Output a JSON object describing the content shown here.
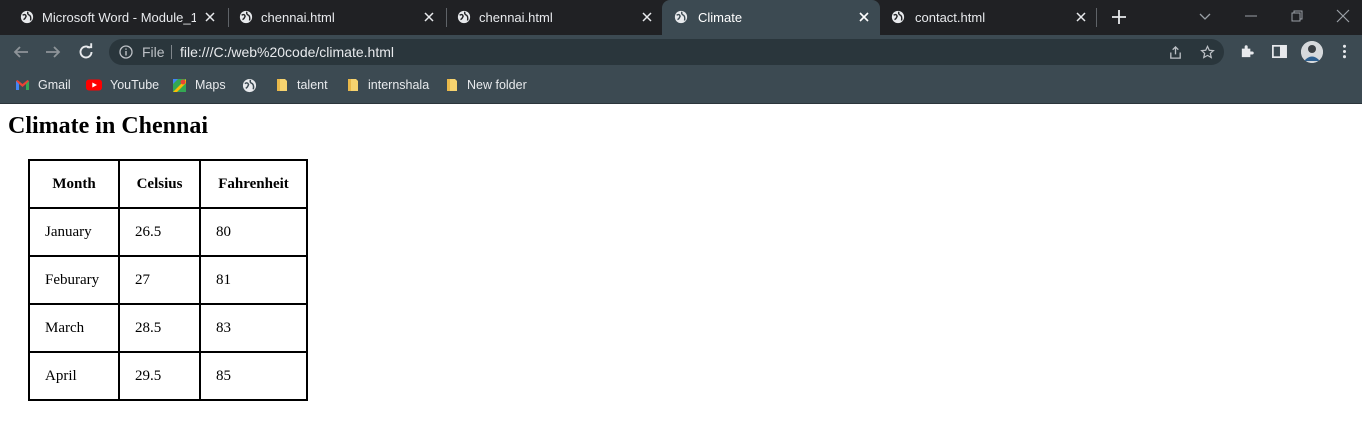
{
  "tabs": [
    {
      "label": "Microsoft Word - Module_1_",
      "active": false
    },
    {
      "label": "chennai.html",
      "active": false
    },
    {
      "label": "chennai.html",
      "active": false
    },
    {
      "label": "Climate",
      "active": true
    },
    {
      "label": "contact.html",
      "active": false
    }
  ],
  "address_bar": {
    "scheme_label": "File",
    "url": "file:///C:/web%20code/climate.html"
  },
  "bookmarks": [
    {
      "label": "Gmail",
      "icon": "gmail-icon"
    },
    {
      "label": "YouTube",
      "icon": "youtube-icon"
    },
    {
      "label": "Maps",
      "icon": "maps-icon"
    },
    {
      "label": "",
      "icon": "globe-icon"
    },
    {
      "label": "talent",
      "icon": "folder-icon"
    },
    {
      "label": "internshala",
      "icon": "folder-icon"
    },
    {
      "label": "New folder",
      "icon": "folder-icon"
    }
  ],
  "page": {
    "heading": "Climate in Chennai",
    "table": {
      "headers": [
        "Month",
        "Celsius",
        "Fahrenheit"
      ],
      "rows": [
        [
          "January",
          "26.5",
          "80"
        ],
        [
          "Feburary",
          "27",
          "81"
        ],
        [
          "March",
          "28.5",
          "83"
        ],
        [
          "April",
          "29.5",
          "85"
        ]
      ]
    }
  },
  "colors": {
    "tabstrip_bg": "#202124",
    "toolbar_bg": "#3c4a52",
    "omnibox_bg": "#2a363c",
    "text_light": "#e8eaed"
  }
}
